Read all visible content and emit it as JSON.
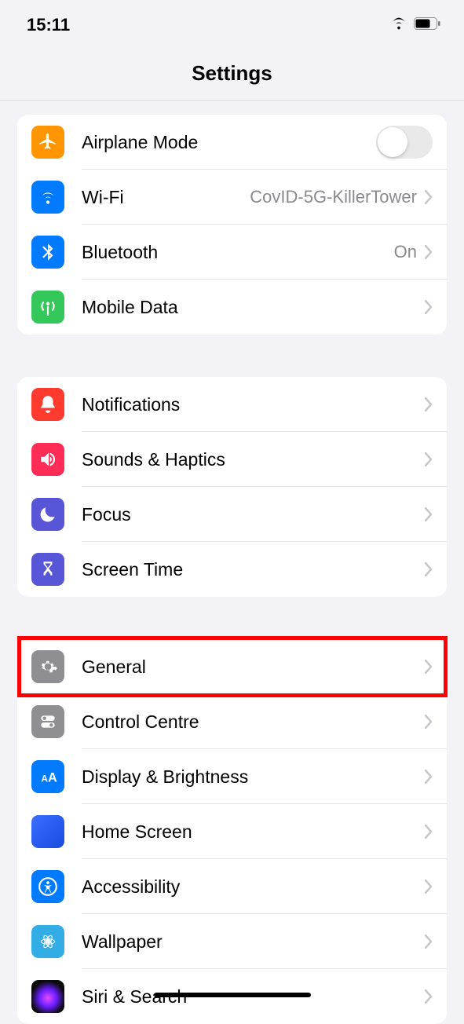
{
  "status": {
    "time": "15:11"
  },
  "header": {
    "title": "Settings"
  },
  "g1": {
    "airplane": {
      "label": "Airplane Mode"
    },
    "wifi": {
      "label": "Wi-Fi",
      "value": "CovID-5G-KillerTower"
    },
    "bluetooth": {
      "label": "Bluetooth",
      "value": "On"
    },
    "mobile": {
      "label": "Mobile Data"
    }
  },
  "g2": {
    "notifications": {
      "label": "Notifications"
    },
    "sounds": {
      "label": "Sounds & Haptics"
    },
    "focus": {
      "label": "Focus"
    },
    "screentime": {
      "label": "Screen Time"
    }
  },
  "g3": {
    "general": {
      "label": "General"
    },
    "control": {
      "label": "Control Centre"
    },
    "display": {
      "label": "Display & Brightness"
    },
    "home": {
      "label": "Home Screen"
    },
    "accessibility": {
      "label": "Accessibility"
    },
    "wallpaper": {
      "label": "Wallpaper"
    },
    "siri": {
      "label": "Siri & Search"
    }
  }
}
